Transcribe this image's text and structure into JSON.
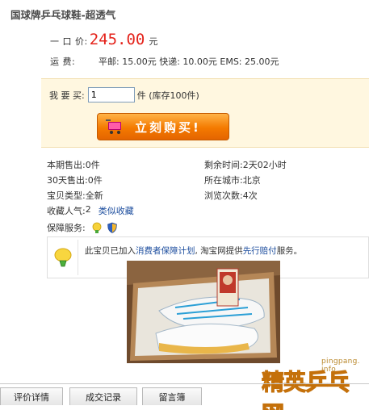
{
  "product": {
    "title": "国球牌乒乓球鞋-超透气",
    "price_label": "一 口 价:",
    "price": "245.00",
    "price_unit": "元",
    "shipping_label": "运      费:",
    "shipping_text": "平邮: 15.00元 快递: 10.00元 EMS: 25.00元"
  },
  "buy": {
    "qty_label": "我 要 买:",
    "qty_value": "1",
    "stock_text": "件 (库存100件)",
    "buy_button": "立刻购买!"
  },
  "info": {
    "sold_label": "本期售出:",
    "sold_value": "0件",
    "remain_label": "剩余时间:",
    "remain_value": "2天02小时",
    "sold30_label": "30天售出:",
    "sold30_value": "0件",
    "city_label": "所在城市:",
    "city_value": "北京",
    "type_label": "宝贝类型:",
    "type_value": "全新",
    "views_label": "浏览次数:",
    "views_value": "4次",
    "fav_label": "收藏人气:",
    "fav_value": "2",
    "similar_link": "类似收藏",
    "guarantee_label": "保障服务:"
  },
  "guarantee_box": {
    "text1": "此宝贝已加入",
    "link1": "消费者保障计划",
    "text2": ", 淘宝网提供",
    "link2": "先行赔付",
    "text3": "服务。"
  },
  "watermark": {
    "site_small": "pingpang. info",
    "brand_a": "精英",
    "brand_b": "乒乓网"
  },
  "tabs": [
    "评价详情",
    "成交记录",
    "留言簿"
  ],
  "colors": {
    "price": "#e4231b",
    "link": "#1c4d9e",
    "buybox_bg": "#fff7e0",
    "buy_button": "#f47a00"
  }
}
